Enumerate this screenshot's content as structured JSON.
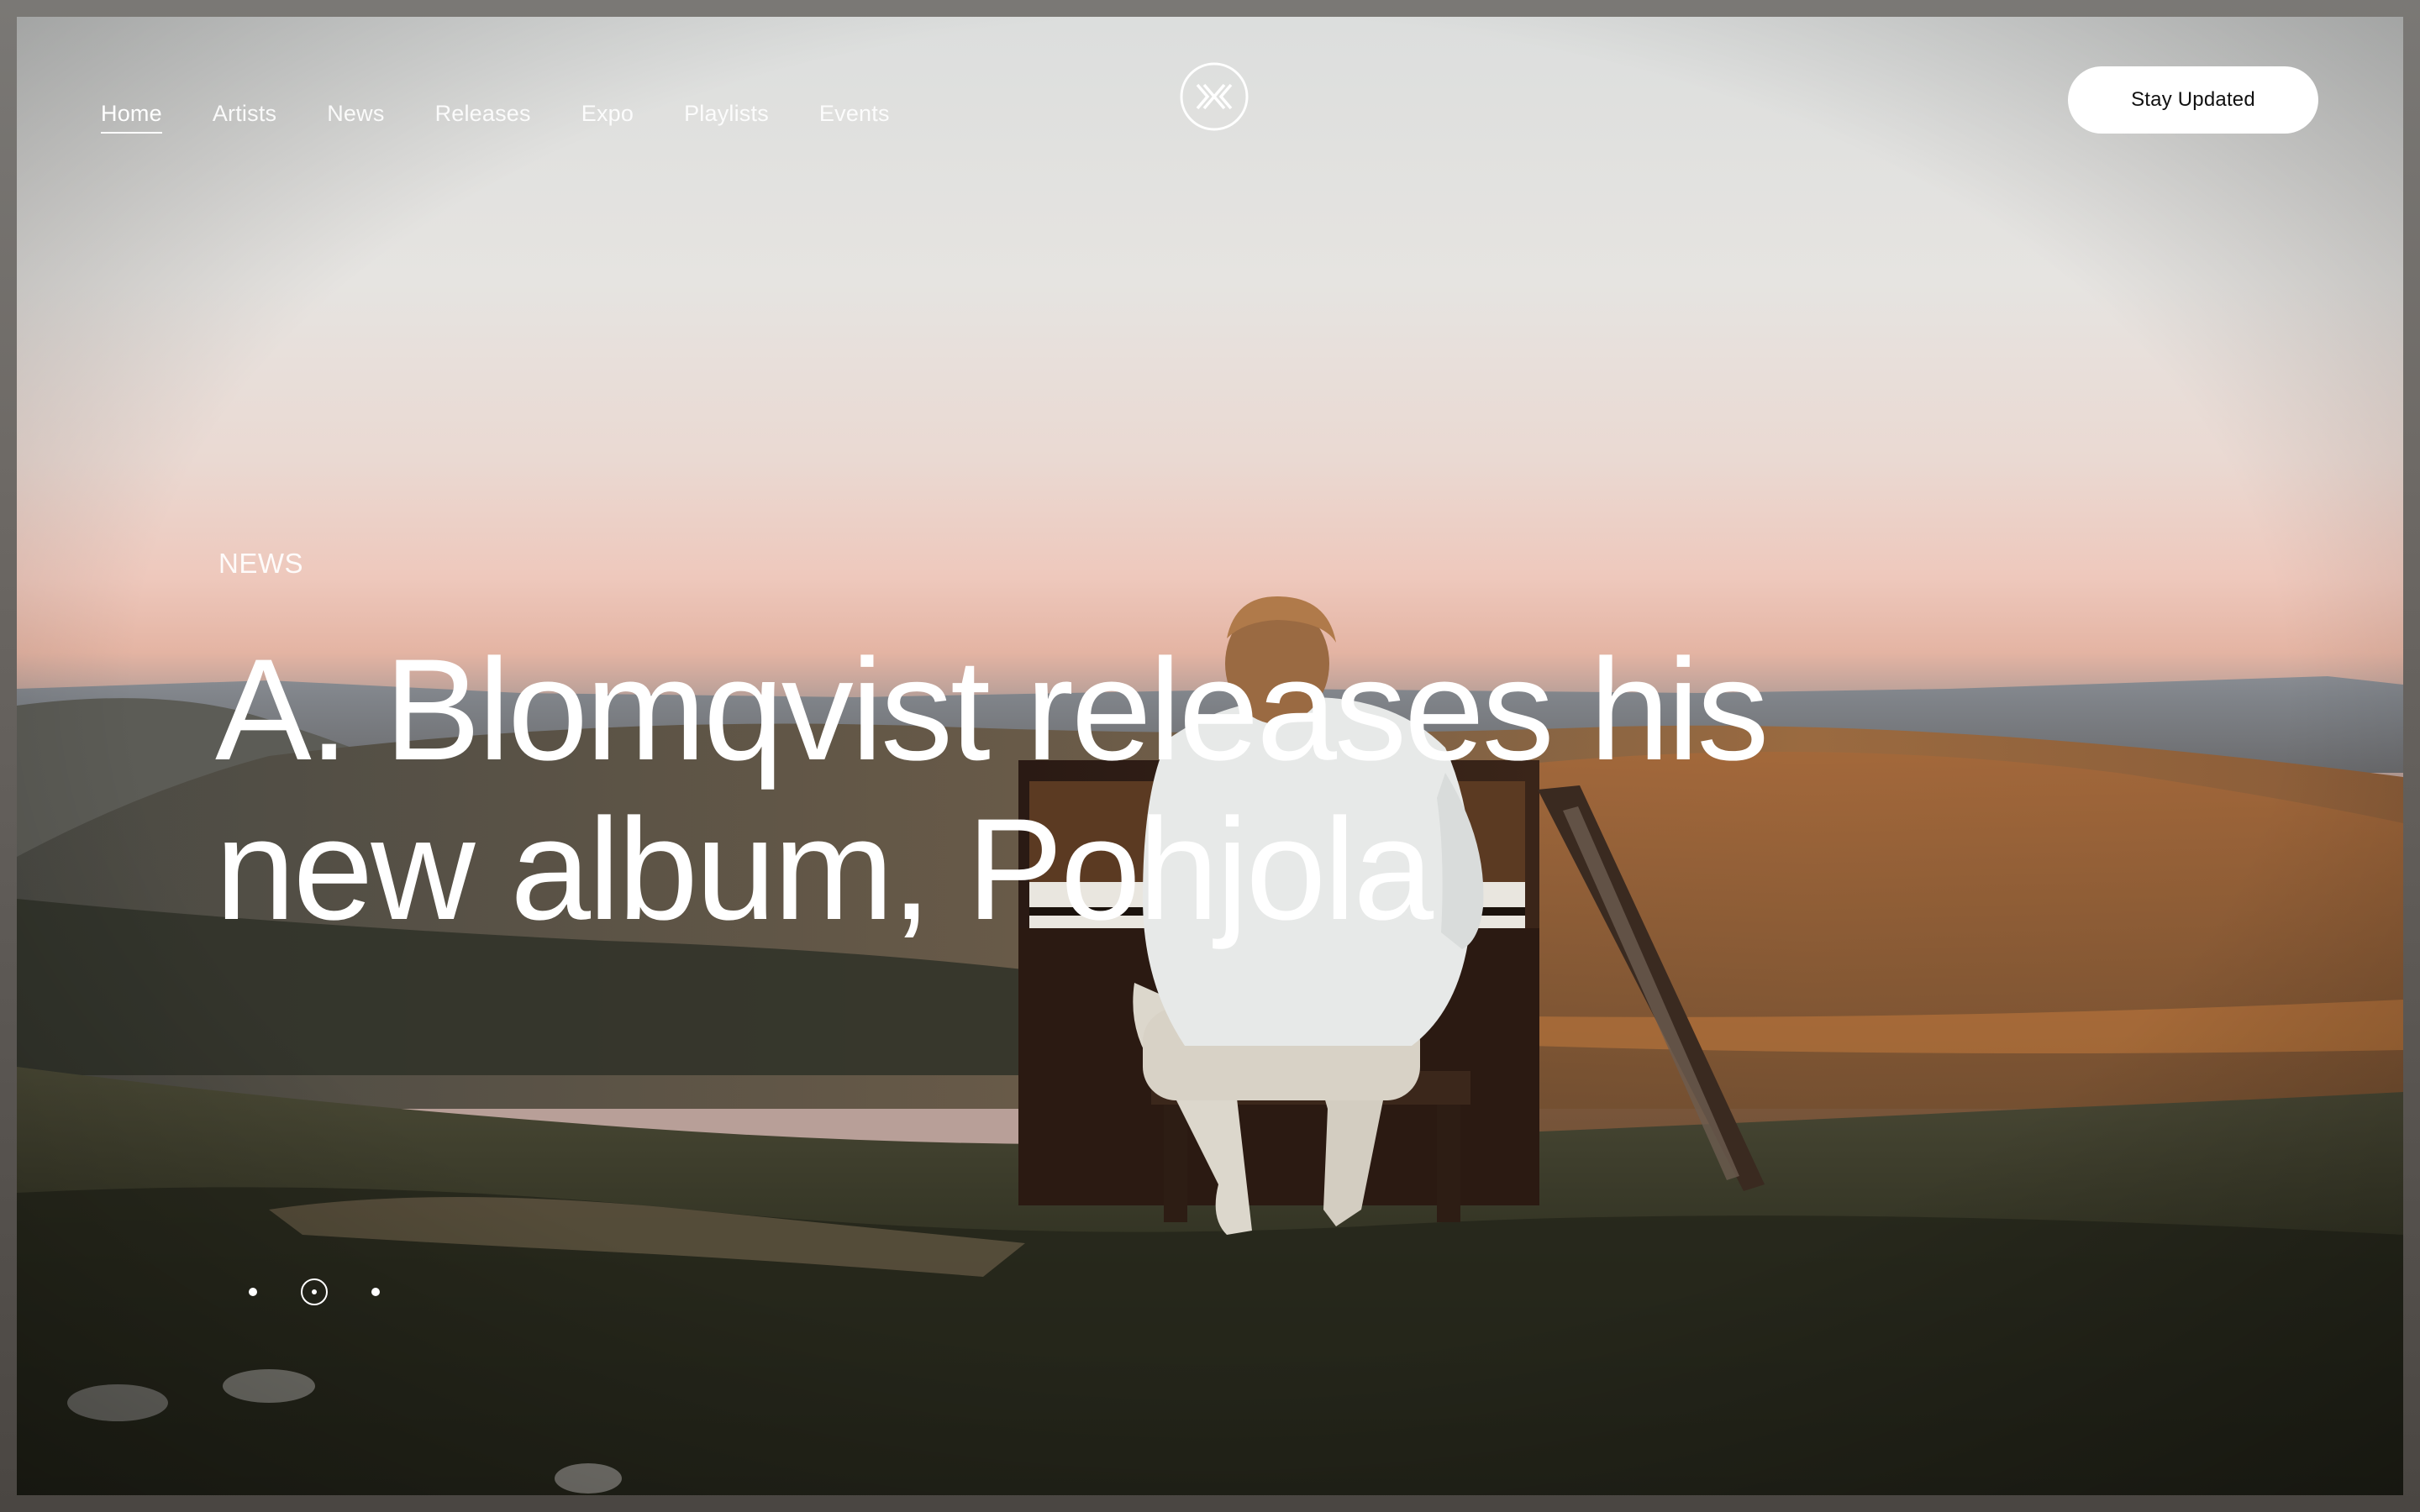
{
  "nav": {
    "items": [
      {
        "label": "Home",
        "active": true
      },
      {
        "label": "Artists"
      },
      {
        "label": "News"
      },
      {
        "label": "Releases"
      },
      {
        "label": "Expo"
      },
      {
        "label": "Playlists"
      },
      {
        "label": "Events"
      }
    ]
  },
  "brand": {
    "logo_icon": "monogram-logo-icon"
  },
  "cta": {
    "label": "Stay Updated"
  },
  "hero": {
    "kicker": "NEWS",
    "headline": "A. Blomqvist releases his new album, Pohjola",
    "image": "pianist-on-hilltop-photo"
  },
  "pager": {
    "count": 3,
    "active_index": 1
  },
  "colors": {
    "text": "#ffffff",
    "button_bg": "#ffffff",
    "button_text": "#111111"
  }
}
